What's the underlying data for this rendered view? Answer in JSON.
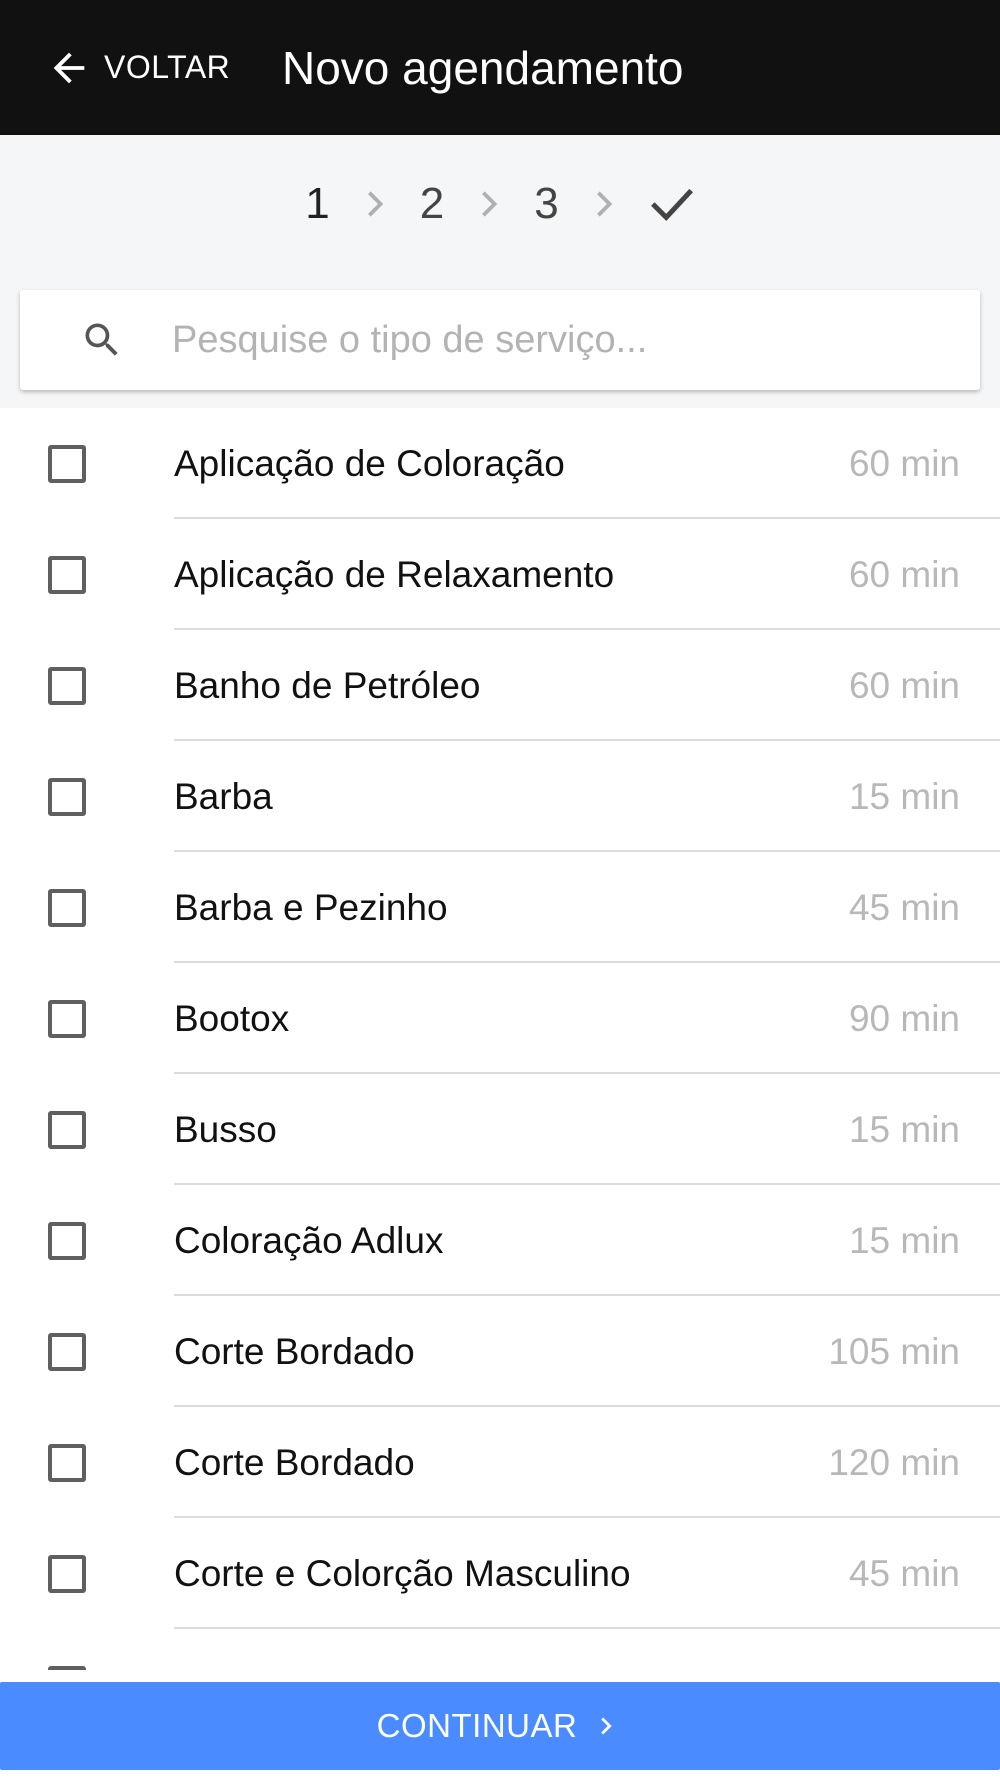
{
  "appbar": {
    "back_label": "VOLTAR",
    "title": "Novo agendamento",
    "back_icon": "arrow-left-icon"
  },
  "stepper": {
    "steps": [
      "1",
      "2",
      "3"
    ],
    "separator_icon": "chevron-right-icon",
    "final_icon": "check-icon"
  },
  "search": {
    "placeholder": "Pesquise o tipo de serviço...",
    "value": "",
    "icon": "search-icon"
  },
  "services": [
    {
      "name": "Aplicação de Coloração",
      "duration": "60 min",
      "checked": false
    },
    {
      "name": "Aplicação de Relaxamento",
      "duration": "60 min",
      "checked": false
    },
    {
      "name": "Banho de Petróleo",
      "duration": "60 min",
      "checked": false
    },
    {
      "name": "Barba",
      "duration": "15 min",
      "checked": false
    },
    {
      "name": "Barba e Pezinho",
      "duration": "45 min",
      "checked": false
    },
    {
      "name": "Bootox",
      "duration": "90 min",
      "checked": false
    },
    {
      "name": "Busso",
      "duration": "15 min",
      "checked": false
    },
    {
      "name": "Coloração Adlux",
      "duration": "15 min",
      "checked": false
    },
    {
      "name": "Corte Bordado",
      "duration": "105 min",
      "checked": false
    },
    {
      "name": "Corte Bordado",
      "duration": "120 min",
      "checked": false
    },
    {
      "name": "Corte e Colorção Masculino",
      "duration": "45 min",
      "checked": false
    }
  ],
  "continue_button": {
    "label": "CONTINUAR",
    "icon": "chevron-right-icon",
    "color": "#4a8cff"
  },
  "colors": {
    "appbar": "#111111",
    "stepper_bg": "#f5f6f7",
    "duration_text": "#b8b8b8"
  }
}
